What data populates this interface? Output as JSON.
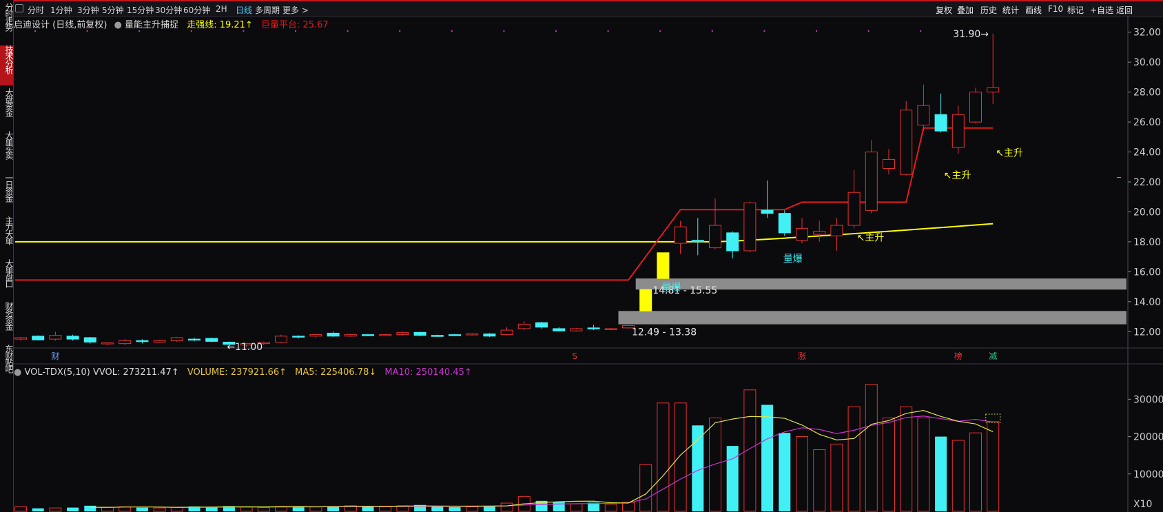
{
  "left_nav": [
    "分时走势",
    "技术分析",
    "大盘资金",
    "大单买卖",
    "一日资金",
    "主力大单",
    "大单盘口",
    "财务资金",
    "东财贴吧"
  ],
  "left_nav_active": 1,
  "timeframes": [
    "分时",
    "1分钟",
    "3分钟",
    "5分钟",
    "15分钟",
    "30分钟",
    "60分钟",
    "2H",
    "日线",
    "多周期",
    "更多 >"
  ],
  "timeframe_active": "日线",
  "right_tools": [
    "复权",
    "叠加",
    "历史",
    "统计",
    "画线",
    "F10",
    "标记",
    "+自选",
    "返回"
  ],
  "main_info": {
    "stock": "启迪设计 (日线,前复权)",
    "indicator": "量能主升捕捉",
    "strong_line": "走强线: 19.21↑",
    "vol_platform": "巨量平台: 25.67"
  },
  "vol_info": {
    "name": "VOL-TDX(5,10) VVOL: 273211.47↑",
    "volume": "VOLUME: 237921.66↑",
    "ma5": "MA5: 225406.78↓",
    "ma10": "MA10: 250140.45↑"
  },
  "colors": {
    "up": "#e8332f",
    "down": "#41f0f5",
    "strong": "#ffff00",
    "platform": "#e41b1b",
    "ma5": "#e6e045",
    "ma10": "#cc33cc",
    "zone": "#8c8c8c"
  },
  "chart_data": [
    {
      "type": "candlestick",
      "title": "启迪设计 (日线,前复权)",
      "ylim": [
        11,
        33
      ],
      "yticks": [
        12,
        14,
        16,
        18,
        20,
        22,
        24,
        26,
        28,
        30,
        32
      ],
      "candles": [
        [
          11.5,
          11.6,
          11.4,
          11.65
        ],
        [
          11.7,
          11.45,
          11.4,
          11.75
        ],
        [
          11.5,
          11.75,
          11.4,
          12.0
        ],
        [
          11.7,
          11.5,
          11.4,
          11.8
        ],
        [
          11.6,
          11.3,
          11.2,
          11.65
        ],
        [
          11.2,
          11.25,
          11.1,
          11.3
        ],
        [
          11.2,
          11.4,
          11.1,
          11.5
        ],
        [
          11.4,
          11.35,
          11.2,
          11.5
        ],
        [
          11.3,
          11.4,
          11.25,
          11.45
        ],
        [
          11.4,
          11.6,
          11.3,
          11.65
        ],
        [
          11.5,
          11.45,
          11.35,
          11.6
        ],
        [
          11.55,
          11.35,
          11.3,
          11.6
        ],
        [
          11.3,
          11.15,
          11.0,
          11.35
        ],
        [
          11.1,
          11.2,
          11.0,
          11.25
        ],
        [
          11.2,
          11.3,
          11.1,
          11.35
        ],
        [
          11.3,
          11.7,
          11.25,
          11.8
        ],
        [
          11.7,
          11.65,
          11.55,
          11.75
        ],
        [
          11.7,
          11.8,
          11.6,
          11.85
        ],
        [
          11.9,
          11.7,
          11.65,
          12.0
        ],
        [
          11.7,
          11.8,
          11.65,
          11.85
        ],
        [
          11.8,
          11.75,
          11.7,
          11.85
        ],
        [
          11.75,
          11.8,
          11.7,
          11.85
        ],
        [
          11.8,
          11.95,
          11.75,
          12.0
        ],
        [
          11.95,
          11.75,
          11.7,
          12.0
        ],
        [
          11.75,
          11.7,
          11.65,
          11.8
        ],
        [
          11.8,
          11.75,
          11.7,
          11.85
        ],
        [
          11.8,
          11.85,
          11.75,
          11.9
        ],
        [
          11.85,
          11.7,
          11.65,
          11.9
        ],
        [
          11.8,
          12.1,
          11.75,
          12.3
        ],
        [
          12.2,
          12.5,
          12.1,
          12.7
        ],
        [
          12.6,
          12.3,
          12.2,
          12.65
        ],
        [
          12.2,
          12.05,
          12.0,
          12.3
        ],
        [
          12.05,
          12.2,
          12.0,
          12.25
        ],
        [
          12.25,
          12.2,
          12.1,
          12.45
        ],
        [
          12.15,
          12.2,
          12.1,
          12.25
        ],
        [
          12.25,
          12.4,
          12.2,
          12.45
        ],
        [
          13.38,
          14.81,
          13.38,
          14.81
        ],
        [
          15.55,
          17.27,
          15.55,
          17.27
        ],
        [
          17.9,
          19.0,
          17.2,
          19.4
        ],
        [
          18.1,
          18.0,
          17.1,
          19.6
        ],
        [
          17.6,
          19.1,
          17.5,
          20.9
        ],
        [
          18.6,
          17.4,
          16.9,
          18.7
        ],
        [
          17.4,
          20.6,
          17.3,
          20.7
        ],
        [
          20.1,
          19.9,
          19.6,
          22.1
        ],
        [
          19.9,
          18.6,
          18.4,
          20.1
        ],
        [
          18.1,
          18.9,
          17.9,
          19.6
        ],
        [
          18.5,
          18.7,
          18.0,
          19.4
        ],
        [
          18.4,
          19.1,
          17.4,
          19.6
        ],
        [
          19.1,
          21.3,
          18.9,
          22.8
        ],
        [
          20.1,
          24.0,
          19.9,
          24.8
        ],
        [
          22.9,
          23.5,
          22.5,
          24.2
        ],
        [
          22.5,
          26.8,
          22.4,
          27.4
        ],
        [
          25.8,
          27.1,
          25.4,
          28.5
        ],
        [
          26.5,
          25.4,
          25.3,
          27.9
        ],
        [
          24.3,
          26.5,
          23.9,
          27.1
        ],
        [
          26.0,
          28.0,
          25.9,
          28.3
        ],
        [
          28.0,
          28.3,
          27.2,
          31.9
        ]
      ],
      "strong_line": {
        "x_start": 0,
        "value_start": 18.0,
        "flat_until": 40,
        "x_end": 56,
        "value_end": 19.21
      },
      "platform_line": [
        [
          0,
          15.45
        ],
        [
          35,
          15.45
        ],
        [
          38,
          20.15
        ],
        [
          44,
          20.15
        ],
        [
          45,
          20.65
        ],
        [
          51,
          20.65
        ],
        [
          52,
          25.6
        ],
        [
          56,
          25.6
        ]
      ],
      "zones": [
        {
          "x_start": 35,
          "label": "12.49 - 13.38",
          "low": 12.49,
          "high": 13.38
        },
        {
          "x_start": 36,
          "label": "14.81 - 15.55",
          "low": 14.81,
          "high": 15.55
        }
      ],
      "annotations": [
        {
          "i": 12,
          "label": "←11.00",
          "price": 11.0
        },
        {
          "i": 56,
          "label": "31.90→",
          "price": 31.9
        },
        {
          "i": 37,
          "label": "量爆",
          "price": 15.55
        },
        {
          "i": 44,
          "label": "量爆",
          "price": 17.5
        },
        {
          "i": 48,
          "label": "主升",
          "price": 18.35
        },
        {
          "i": 53,
          "label": "主升",
          "price": 22.5
        },
        {
          "i": 56,
          "label": "主升",
          "price": 24.0
        }
      ],
      "markers": [
        {
          "i": 2,
          "label": "财"
        },
        {
          "i": 32,
          "label": "S"
        },
        {
          "i": 45,
          "label": "涨"
        },
        {
          "i": 54,
          "label": "榜"
        },
        {
          "i": 56,
          "label": "减"
        }
      ]
    },
    {
      "type": "bar",
      "title": "VOL-TDX(5,10)",
      "ylim": [
        0,
        38000
      ],
      "yticks": [
        10000,
        20000,
        30000
      ],
      "scale_label": "X10",
      "volumes": [
        1200,
        800,
        900,
        1000,
        1500,
        1100,
        1200,
        1000,
        900,
        1100,
        1300,
        1200,
        1400,
        1100,
        1000,
        1300,
        1400,
        1200,
        1400,
        1500,
        1300,
        1200,
        1500,
        1700,
        1400,
        1100,
        1200,
        1300,
        2200,
        4000,
        2800,
        2500,
        2000,
        2300,
        1900,
        2400,
        12500,
        29000,
        29000,
        23000,
        25000,
        17500,
        32500,
        28500,
        21000,
        20000,
        16500,
        18000,
        28000,
        34000,
        25000,
        28000,
        25000,
        20000,
        19000,
        21000,
        24000
      ],
      "ma5": [
        null,
        null,
        null,
        null,
        1080,
        1060,
        1140,
        1160,
        1140,
        1060,
        1100,
        1140,
        1180,
        1200,
        1180,
        1220,
        1240,
        1200,
        1260,
        1360,
        1360,
        1320,
        1380,
        1460,
        1420,
        1380,
        1380,
        1400,
        1460,
        2000,
        2340,
        2560,
        2700,
        2720,
        2300,
        2220,
        4620,
        9520,
        15040,
        19180,
        23700,
        24700,
        25400,
        25300,
        24900,
        23100,
        20600,
        19100,
        19500,
        23300,
        24300,
        26200,
        27000,
        25400,
        24100,
        23400,
        21300
      ],
      "ma10": [
        null,
        null,
        null,
        null,
        null,
        null,
        null,
        null,
        null,
        1070,
        1080,
        1100,
        1150,
        1160,
        1120,
        1140,
        1170,
        1190,
        1230,
        1270,
        1290,
        1280,
        1290,
        1330,
        1320,
        1320,
        1330,
        1340,
        1440,
        1690,
        1850,
        1960,
        2030,
        2090,
        2130,
        2270,
        3300,
        5940,
        8630,
        10960,
        12650,
        14060,
        16790,
        19400,
        21260,
        22350,
        21900,
        20800,
        21700,
        23000,
        23800,
        25100,
        25500,
        24800,
        24100,
        24600,
        23900
      ]
    }
  ]
}
